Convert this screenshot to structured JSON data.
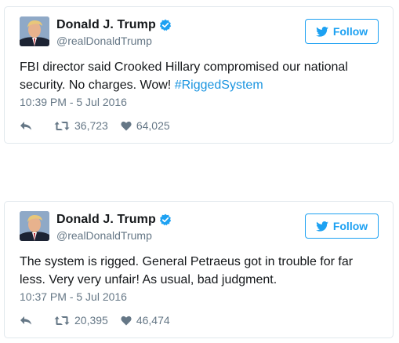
{
  "colors": {
    "accent": "#1da1f2",
    "text": "#14171a",
    "muted": "#657786",
    "border": "#e1e8ed",
    "hashtag": "#1b95e0"
  },
  "tweets": [
    {
      "display_name": "Donald J. Trump",
      "handle": "@realDonaldTrump",
      "follow_label": "Follow",
      "text_before": "FBI director said Crooked Hillary compromised our national security. No charges. Wow! ",
      "hashtag": "#RiggedSystem",
      "timestamp": "10:39 PM - 5 Jul 2016",
      "retweets": "36,723",
      "likes": "64,025",
      "icons": [
        "verified-badge-icon",
        "twitter-bird-icon",
        "reply-icon",
        "retweet-icon",
        "heart-icon"
      ]
    },
    {
      "display_name": "Donald J. Trump",
      "handle": "@realDonaldTrump",
      "follow_label": "Follow",
      "text_before": "The system is rigged. General Petraeus got in trouble for far less. Very very unfair! As usual, bad judgment.",
      "hashtag": "",
      "timestamp": "10:37 PM - 5 Jul 2016",
      "retweets": "20,395",
      "likes": "46,474",
      "icons": [
        "verified-badge-icon",
        "twitter-bird-icon",
        "reply-icon",
        "retweet-icon",
        "heart-icon"
      ]
    }
  ]
}
